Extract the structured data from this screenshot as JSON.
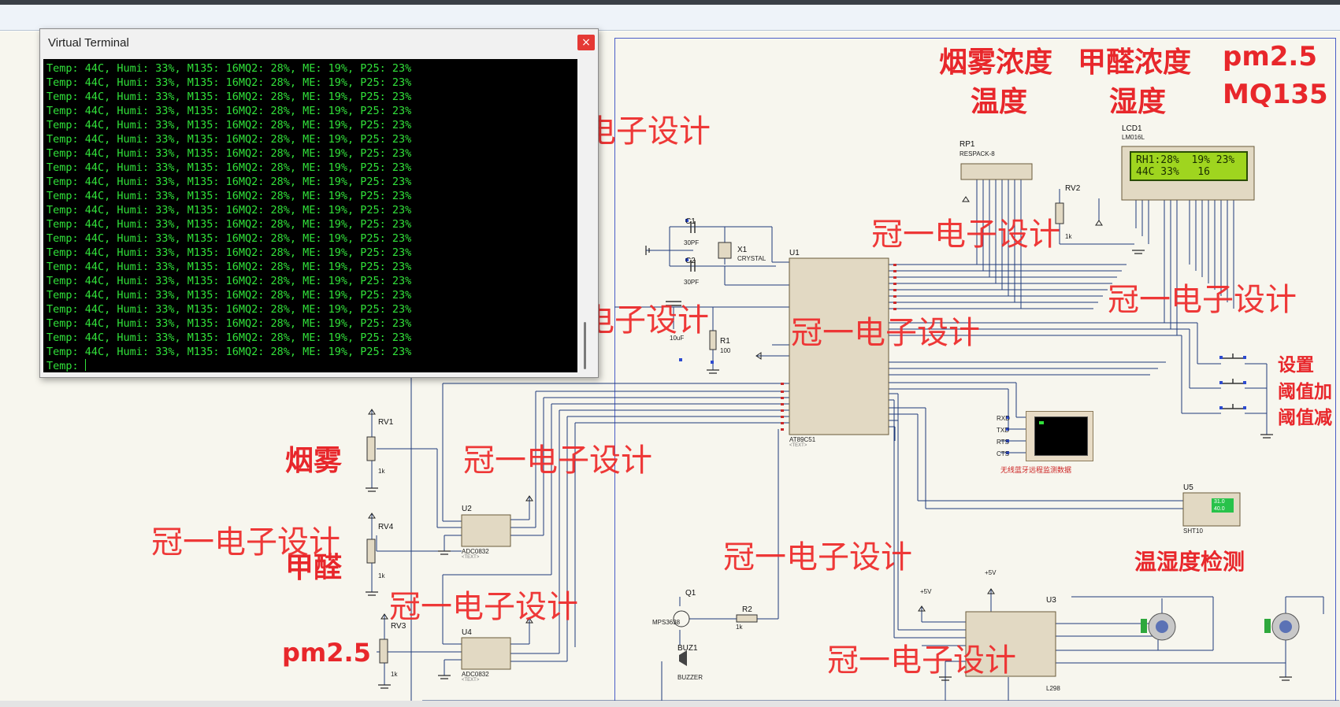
{
  "window": {
    "title": "Virtual Terminal",
    "close_symbol": "×"
  },
  "terminal": {
    "lines": [
      "Temp: 44C, Humi: 33%, M135: 16MQ2: 28%, ME: 19%, P25: 23%",
      "Temp: 44C, Humi: 33%, M135: 16MQ2: 28%, ME: 19%, P25: 23%",
      "Temp: 44C, Humi: 33%, M135: 16MQ2: 28%, ME: 19%, P25: 23%",
      "Temp: 44C, Humi: 33%, M135: 16MQ2: 28%, ME: 19%, P25: 23%",
      "Temp: 44C, Humi: 33%, M135: 16MQ2: 28%, ME: 19%, P25: 23%",
      "Temp: 44C, Humi: 33%, M135: 16MQ2: 28%, ME: 19%, P25: 23%",
      "Temp: 44C, Humi: 33%, M135: 16MQ2: 28%, ME: 19%, P25: 23%",
      "Temp: 44C, Humi: 33%, M135: 16MQ2: 28%, ME: 19%, P25: 23%",
      "Temp: 44C, Humi: 33%, M135: 16MQ2: 28%, ME: 19%, P25: 23%",
      "Temp: 44C, Humi: 33%, M135: 16MQ2: 28%, ME: 19%, P25: 23%",
      "Temp: 44C, Humi: 33%, M135: 16MQ2: 28%, ME: 19%, P25: 23%",
      "Temp: 44C, Humi: 33%, M135: 16MQ2: 28%, ME: 19%, P25: 23%",
      "Temp: 44C, Humi: 33%, M135: 16MQ2: 28%, ME: 19%, P25: 23%",
      "Temp: 44C, Humi: 33%, M135: 16MQ2: 28%, ME: 19%, P25: 23%",
      "Temp: 44C, Humi: 33%, M135: 16MQ2: 28%, ME: 19%, P25: 23%",
      "Temp: 44C, Humi: 33%, M135: 16MQ2: 28%, ME: 19%, P25: 23%",
      "Temp: 44C, Humi: 33%, M135: 16MQ2: 28%, ME: 19%, P25: 23%",
      "Temp: 44C, Humi: 33%, M135: 16MQ2: 28%, ME: 19%, P25: 23%",
      "Temp: 44C, Humi: 33%, M135: 16MQ2: 28%, ME: 19%, P25: 23%",
      "Temp: 44C, Humi: 33%, M135: 16MQ2: 28%, ME: 19%, P25: 23%",
      "Temp: 44C, Humi: 33%, M135: 16MQ2: 28%, ME: 19%, P25: 23%"
    ],
    "prompt": "Temp: "
  },
  "headings": {
    "row1": [
      "烟雾浓度",
      "甲醛浓度",
      "pm2.5"
    ],
    "row2": [
      "温度",
      "湿度",
      "MQ135"
    ]
  },
  "watermark": "冠一电子设计",
  "button_labels": [
    "设置",
    "阈值加",
    "阈值减"
  ],
  "sensor_labels": {
    "smoke": "烟雾",
    "formaldehyde": "甲醛",
    "pm25": "pm2.5"
  },
  "temp_humidity_label": "温湿度检测",
  "bluetooth_label": "无线蓝牙远程监测数据",
  "lcd": {
    "ref": "LCD1",
    "part": "LM016L",
    "line1": "RH1:28%  19% 23%",
    "line2": "44C 33%   16"
  },
  "components": {
    "u1": {
      "ref": "U1",
      "part": "AT89C51"
    },
    "u2": {
      "ref": "U2",
      "part": "ADC0832"
    },
    "u4": {
      "ref": "U4",
      "part": "ADC0832"
    },
    "u3": {
      "ref": "U3",
      "part": "L298"
    },
    "u5": {
      "ref": "U5",
      "part": "SHT10",
      "temp": "31.0",
      "humi": "40.0"
    },
    "rp1": {
      "ref": "RP1",
      "part": "RESPACK-8"
    },
    "rv1": {
      "ref": "RV1",
      "value": "1k"
    },
    "rv2": {
      "ref": "RV2",
      "value": "1k"
    },
    "rv3": {
      "ref": "RV3",
      "value": "1k"
    },
    "rv4": {
      "ref": "RV4",
      "value": "1k"
    },
    "c1": {
      "ref": "C1",
      "value": "30PF"
    },
    "c2": {
      "ref": "C2",
      "value": "30PF"
    },
    "c3": {
      "ref": "C3",
      "value": "10uF"
    },
    "x1": {
      "ref": "X1",
      "part": "CRYSTAL"
    },
    "r1": {
      "ref": "R1",
      "value": "100"
    },
    "r2": {
      "ref": "R2",
      "value": "1k"
    },
    "q1": {
      "ref": "Q1",
      "part": "MPS3638"
    },
    "buz1": {
      "ref": "BUZ1",
      "part": "BUZZER"
    },
    "text_tag": "<TEXT>",
    "v5": "+5V"
  },
  "colors": {
    "terminal_bg": "#000000",
    "terminal_text": "#31e13a",
    "annotation_red": "#e8272b",
    "wire": "#1f3b7a",
    "chip_fill": "#e2d9c3",
    "lcd_green": "#9fd51f"
  }
}
